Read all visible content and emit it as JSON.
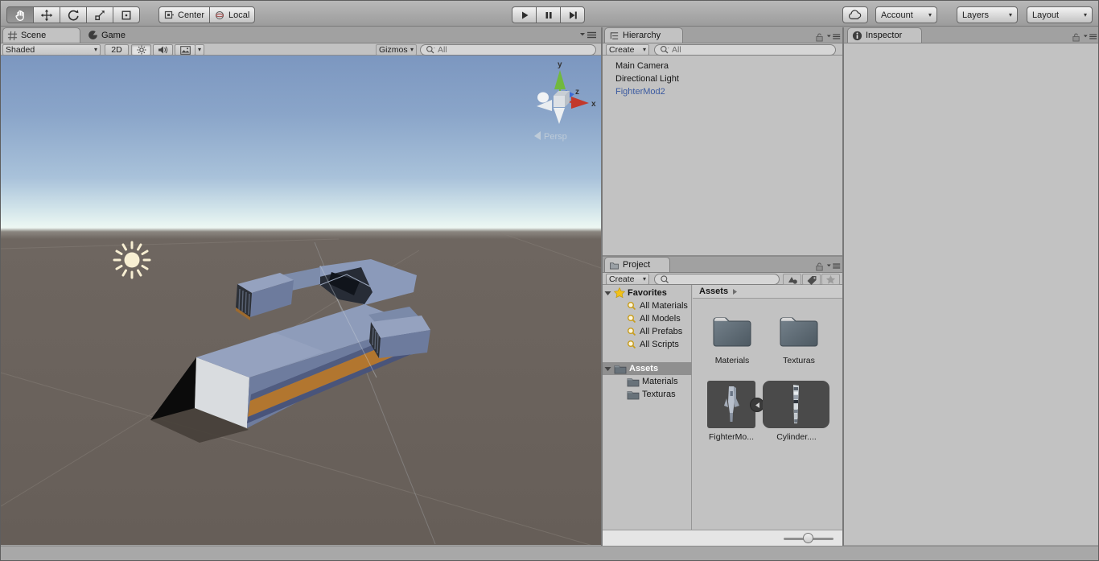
{
  "toolbar": {
    "center_label": "Center",
    "local_label": "Local",
    "account_label": "Account",
    "layers_label": "Layers",
    "layout_label": "Layout"
  },
  "scene_view": {
    "scene_tab": "Scene",
    "game_tab": "Game",
    "shading_mode": "Shaded",
    "toggle_2d": "2D",
    "gizmos_label": "Gizmos",
    "search_filter": "All",
    "axis_x": "x",
    "axis_y": "y",
    "axis_z": "z",
    "projection_label": "Persp"
  },
  "hierarchy": {
    "tab_title": "Hierarchy",
    "create_label": "Create",
    "search_filter": "All",
    "items": [
      "Main Camera",
      "Directional Light",
      "FighterMod2"
    ]
  },
  "project": {
    "tab_title": "Project",
    "create_label": "Create",
    "favorites_label": "Favorites",
    "favorites_items": [
      "All Materials",
      "All Models",
      "All Prefabs",
      "All Scripts"
    ],
    "assets_root": "Assets",
    "assets_children": [
      "Materials",
      "Texturas"
    ],
    "breadcrumb": "Assets",
    "grid_folders": [
      "Materials",
      "Texturas"
    ],
    "grid_assets": [
      "FighterMo...",
      "Cylinder...."
    ]
  },
  "inspector": {
    "tab_title": "Inspector"
  },
  "colors": {
    "panel": "#c2c2c2",
    "chrome": "#a1a1a1",
    "prefab_text": "#3b5aa0",
    "sky_top": "#7c97c0",
    "sky_horizon": "#eef7f3",
    "ground": "#6b635d",
    "stripe_orange": "#b2762f"
  }
}
